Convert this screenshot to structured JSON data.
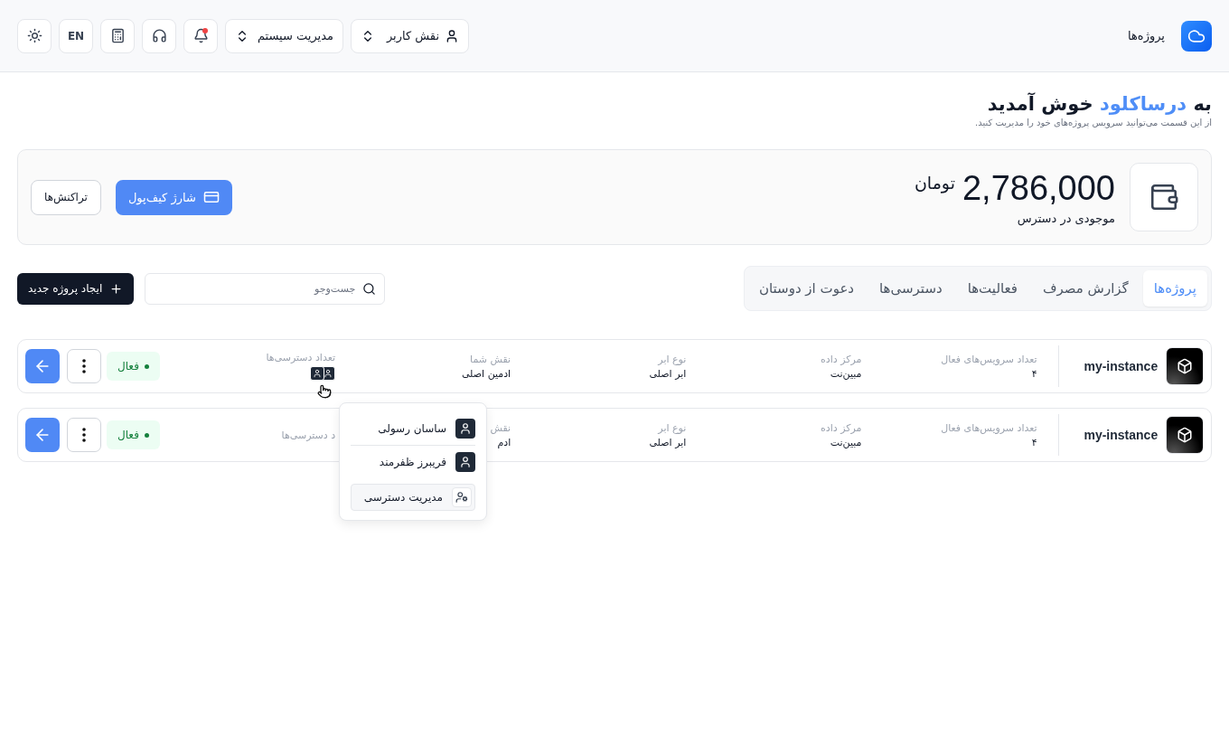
{
  "header": {
    "nav_label": "پروژه‌ها",
    "role_select": "نقش کاربر",
    "system_select": "مدیریت سیستم",
    "notification_unread": true,
    "language": "EN"
  },
  "welcome": {
    "prefix": "به",
    "brand": "درساکلود",
    "suffix": "خوش آمدید",
    "subtitle": "از این قسمت می‌توانید سرویس پروژه‌های خود را مدیریت کنید."
  },
  "wallet": {
    "amount": "2,786,000",
    "currency": "تومان",
    "label": "موجودی در دسترس",
    "charge_button": "شارژ کیف‌پول",
    "transactions_button": "تراکنش‌ها"
  },
  "tabs": [
    {
      "label": "پروژه‌ها",
      "selected": true
    },
    {
      "label": "گزارش مصرف",
      "selected": false
    },
    {
      "label": "فعالیت‌ها",
      "selected": false
    },
    {
      "label": "دسترسی‌ها",
      "selected": false
    },
    {
      "label": "دعوت از دوستان",
      "selected": false
    }
  ],
  "search": {
    "placeholder": "جست‌وجو"
  },
  "create_button": "ایجاد پروژه جدید",
  "projects": [
    {
      "name": "my-instance",
      "columns": [
        {
          "kind": "text",
          "label": "تعداد سرویس‌های فعال",
          "value": "۴"
        },
        {
          "kind": "text",
          "label": "مرکز داده",
          "value": "مبین‌نت"
        },
        {
          "kind": "text",
          "label": "نوع ابر",
          "value": "ابر اصلی"
        },
        {
          "kind": "text",
          "label": "نقش شما",
          "value": "ادمین اصلی"
        },
        {
          "kind": "access",
          "label": "تعداد دسترسی‌ها"
        }
      ],
      "status": {
        "label": "فعال",
        "active": true
      }
    },
    {
      "name": "my-instance",
      "columns": [
        {
          "kind": "text",
          "label": "تعداد سرویس‌های فعال",
          "value": "۴"
        },
        {
          "kind": "text",
          "label": "مرکز داده",
          "value": "مبین‌نت"
        },
        {
          "kind": "text",
          "label": "نوع ابر",
          "value": "ابر اصلی"
        },
        {
          "kind": "text",
          "label": "نقش",
          "value": "ادم"
        },
        {
          "kind": "text",
          "label": "د دسترسی‌ها"
        }
      ],
      "status": {
        "label": "فعال",
        "active": true
      }
    }
  ],
  "access_popover": {
    "members": [
      "ساسان رسولی",
      "فریبرز ظفرمند"
    ],
    "manage": "مدیریت دسترسی"
  }
}
